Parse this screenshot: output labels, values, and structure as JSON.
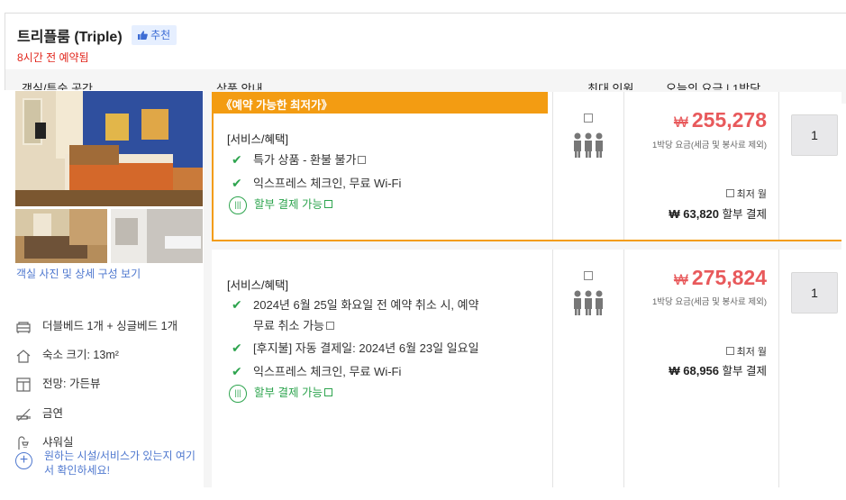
{
  "room": {
    "title": "트리플룸 (Triple)",
    "recommend_label": "추천",
    "booked_note": "8시간 전 예약됨"
  },
  "columns": {
    "room_space": "객실/투숙 공간",
    "product": "상품 안내",
    "max_guests": "최대 인원",
    "price": "오늘의 요금 | 1박당"
  },
  "left": {
    "photo_link": "객실 사진 및 상세 구성 보기",
    "features": [
      {
        "icon": "bed-icon",
        "label": "더블베드 1개 + 싱글베드 1개"
      },
      {
        "icon": "house-icon",
        "label": "숙소 크기: 13m²"
      },
      {
        "icon": "window-icon",
        "label": "전망: 가든뷰"
      },
      {
        "icon": "no-smoking-icon",
        "label": "금연"
      },
      {
        "icon": "shower-icon",
        "label": "샤워실"
      }
    ],
    "more_link": "원하는 시설/서비스가 있는지 여기서 확인하세요!"
  },
  "offers": [
    {
      "ribbon": "《예약 가능한 최저가》",
      "services_title": "[서비스/혜택]",
      "items": [
        "특가 상품 - 환불 불가",
        "익스프레스 체크인, 무료 Wi-Fi"
      ],
      "installment": "할부 결제 가능",
      "currency": "₩",
      "price": "255,278",
      "per_night": "1박당 요금(세금 및 봉사료 제외)",
      "monthly_label": "최저 월",
      "installment_price": "₩ 63,820",
      "installment_suffix": "할부 결제",
      "quantity": "1"
    },
    {
      "services_title": "[서비스/혜택]",
      "items": [
        "2024년 6월 25일 화요일 전 예약 취소 시, 예약",
        "무료 취소 가능",
        "[후지불] 자동 결제일: 2024년 6월 23일 일요일",
        "익스프레스 체크인, 무료 Wi-Fi"
      ],
      "installment": "할부 결제 가능",
      "currency": "₩",
      "price": "275,824",
      "per_night": "1박당 요금(세금 및 봉사료 제외)",
      "monthly_label": "최저 월",
      "installment_price": "₩ 68,956",
      "installment_suffix": "할부 결제",
      "quantity": "1"
    }
  ],
  "colors": {
    "accent_orange": "#f39c12",
    "price_red": "#e8595b",
    "check_green": "#2da44e",
    "link_blue": "#4f78cf"
  }
}
